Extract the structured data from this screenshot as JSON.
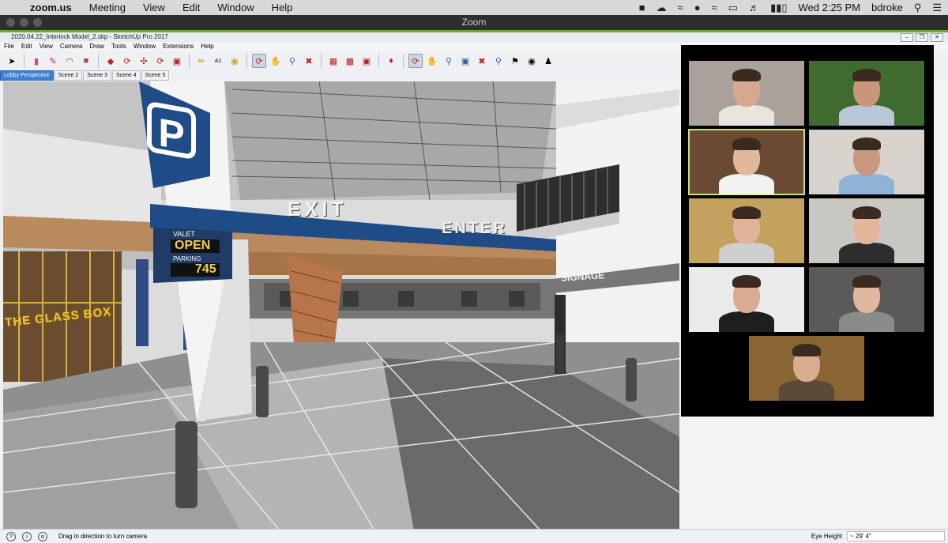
{
  "menubar": {
    "app": "zoom.us",
    "items": [
      "Meeting",
      "View",
      "Edit",
      "Window",
      "Help"
    ],
    "clock": "Wed 2:25 PM",
    "user": "bdroke"
  },
  "zoom": {
    "window_title": "Zoom"
  },
  "sketchup": {
    "title": "2020.04.22_Interlock Model_2.skp - SketchUp Pro 2017",
    "menu": [
      "File",
      "Edit",
      "View",
      "Camera",
      "Draw",
      "Tools",
      "Window",
      "Extensions",
      "Help"
    ],
    "tabs": [
      "Lobby Perspective",
      "Scene 2",
      "Scene 3",
      "Scene 4",
      "Scene 5"
    ],
    "active_tab": 0,
    "status_hint": "Drag in direction to turn camera",
    "eye_height_label": "Eye Height",
    "eye_height_value": "~ 29' 4\"",
    "toolbar_icons": [
      "select-icon",
      "eraser-icon",
      "pencil-icon",
      "arc-icon",
      "rectangle-icon",
      "push-pull-icon",
      "follow-me-icon",
      "move-icon",
      "rotate-icon",
      "scale-icon",
      "tape-measure-icon",
      "text-icon",
      "paint-bucket-icon",
      "orbit-icon",
      "pan-icon",
      "zoom-icon",
      "zoom-extents-icon",
      "warehouse-icon",
      "extension-icon",
      "component-icon",
      "ruby-icon",
      "orbit-icon-2",
      "pan-icon-2",
      "zoom-icon-2",
      "zoom-window-icon",
      "zoom-extents-icon-2",
      "previous-view-icon",
      "position-camera-icon",
      "look-around-icon",
      "walk-icon"
    ]
  },
  "scene": {
    "parking_sign_letter": "P",
    "exit_label": "EXIT",
    "enter_label": "ENTER",
    "valet_label": "VALET",
    "open_label": "OPEN",
    "parking_label": "PARKING",
    "parking_count": "745",
    "store_sign": "THE GLASS BOX",
    "signage_label": "SIGNAGE"
  },
  "participants": [
    {
      "tile": 1,
      "bg": "#a9a19a",
      "skin": "#d6a98e",
      "shirt": "#e9e4de"
    },
    {
      "tile": 2,
      "bg": "#3f6b2f",
      "skin": "#c9957b",
      "shirt": "#b9c7d6"
    },
    {
      "tile": 3,
      "bg": "#6a4a32",
      "skin": "#e0b89b",
      "shirt": "#f2f2f2",
      "speaking": true
    },
    {
      "tile": 4,
      "bg": "#d7d2cc",
      "skin": "#c8977f",
      "shirt": "#8fb3d6"
    },
    {
      "tile": 5,
      "bg": "#c3a25e",
      "skin": "#e0b49a",
      "shirt": "#cfcfcf"
    },
    {
      "tile": 6,
      "bg": "#c9c7c2",
      "skin": "#e2b79c",
      "shirt": "#2d2d2d"
    },
    {
      "tile": 7,
      "bg": "#eaeaea",
      "skin": "#d8ab92",
      "shirt": "#1e1e1e"
    },
    {
      "tile": 8,
      "bg": "#5b5a58",
      "skin": "#e0b89e",
      "shirt": "#8a8a88"
    },
    {
      "tile": 9,
      "bg": "#8a6534",
      "skin": "#d7ad92",
      "shirt": "#5a4a38"
    }
  ]
}
